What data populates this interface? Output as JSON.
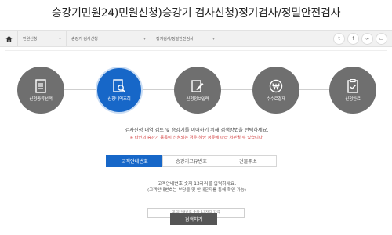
{
  "page": {
    "title": "승강기민원24)민원신청)승강기 검사신청)정기검사/정밀안전검사"
  },
  "breadcrumb": {
    "home_icon": "home-icon",
    "items": [
      {
        "label": "민원신청"
      },
      {
        "label": "승강기 검사신청"
      },
      {
        "label": "정기검사/정밀안전검사"
      }
    ],
    "tools": [
      {
        "icon": "twitter-icon",
        "glyph": "t"
      },
      {
        "icon": "facebook-icon",
        "glyph": "f"
      },
      {
        "icon": "link-icon",
        "glyph": "∞"
      },
      {
        "icon": "print-icon",
        "glyph": "▭"
      }
    ]
  },
  "steps": [
    {
      "label": "신청종류선택",
      "icon": "document-icon",
      "active": false
    },
    {
      "label": "신청내역조회",
      "icon": "search-document-icon",
      "active": true
    },
    {
      "label": "신청정보입력",
      "icon": "edit-icon",
      "active": false
    },
    {
      "label": "수수료결제",
      "icon": "won-icon",
      "active": false
    },
    {
      "label": "신청완료",
      "icon": "clipboard-check-icon",
      "active": false
    }
  ],
  "notice": {
    "main": "검사신청 내역 검토 및 승강기를 이어하기 위해 검색방법을 선택하세요.",
    "sub": "※ 타인의 승강기 등록이 신청되는 경우 해당 정류에 따라 처분될 수 있습니다."
  },
  "tabs": [
    {
      "label": "고객안내번호",
      "active": true
    },
    {
      "label": "승강기고유번호",
      "active": false
    },
    {
      "label": "건물주소",
      "active": false
    }
  ],
  "form": {
    "desc1": "고객안내번호 숫자 13자리를 입력하세요.",
    "desc2": "(고객안내번호는 부당을 및 안내문자를 통해 확인 가능)",
    "input_placeholder": "고객안내번호 숫자 13자리 입력",
    "search_label": "검색하기"
  }
}
